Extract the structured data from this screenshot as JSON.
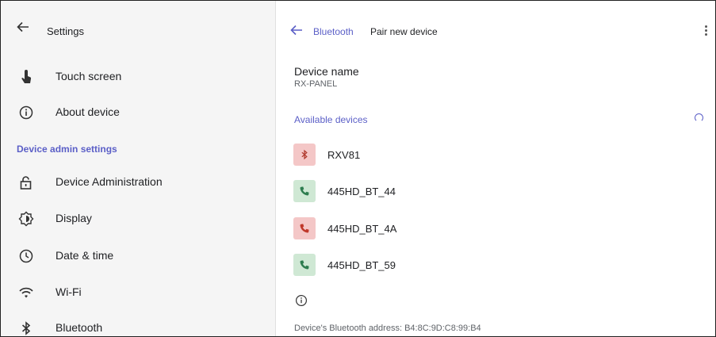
{
  "left_panel": {
    "header": {
      "title": "Settings",
      "back_icon": "arrow-left-icon"
    },
    "items_top": [
      {
        "label": "Touch screen",
        "icon": "touch-icon"
      },
      {
        "label": "About device",
        "icon": "info-icon"
      }
    ],
    "section_header": "Device admin settings",
    "items_admin": [
      {
        "label": "Device Administration",
        "icon": "lock-open-icon"
      },
      {
        "label": "Display",
        "icon": "display-brightness-icon"
      },
      {
        "label": "Date & time",
        "icon": "clock-icon"
      },
      {
        "label": "Wi-Fi",
        "icon": "wifi-icon"
      },
      {
        "label": "Bluetooth",
        "icon": "bluetooth-icon"
      }
    ]
  },
  "right_panel": {
    "breadcrumb": {
      "parent": "Bluetooth",
      "current": "Pair new device"
    },
    "device_name": {
      "label": "Device name",
      "value": "RX-PANEL"
    },
    "available_header": "Available devices",
    "devices": [
      {
        "name": "RXV81",
        "icon": "bluetooth-icon",
        "icon_bg": "#f4c7c7"
      },
      {
        "name": "445HD_BT_44",
        "icon": "phone-icon",
        "icon_bg": "#cfe8d4"
      },
      {
        "name": "445HD_BT_4A",
        "icon": "phone-icon",
        "icon_bg": "#f4c7c7"
      },
      {
        "name": "445HD_BT_59",
        "icon": "phone-icon",
        "icon_bg": "#cfe8d4"
      }
    ],
    "bluetooth_address": "Device's Bluetooth address: B4:8C:9D:C8:99:B4"
  },
  "colors": {
    "accent": "#5b5fc7",
    "phone_icon": "#2e7d4f",
    "bt_icon": "#c0392b"
  }
}
